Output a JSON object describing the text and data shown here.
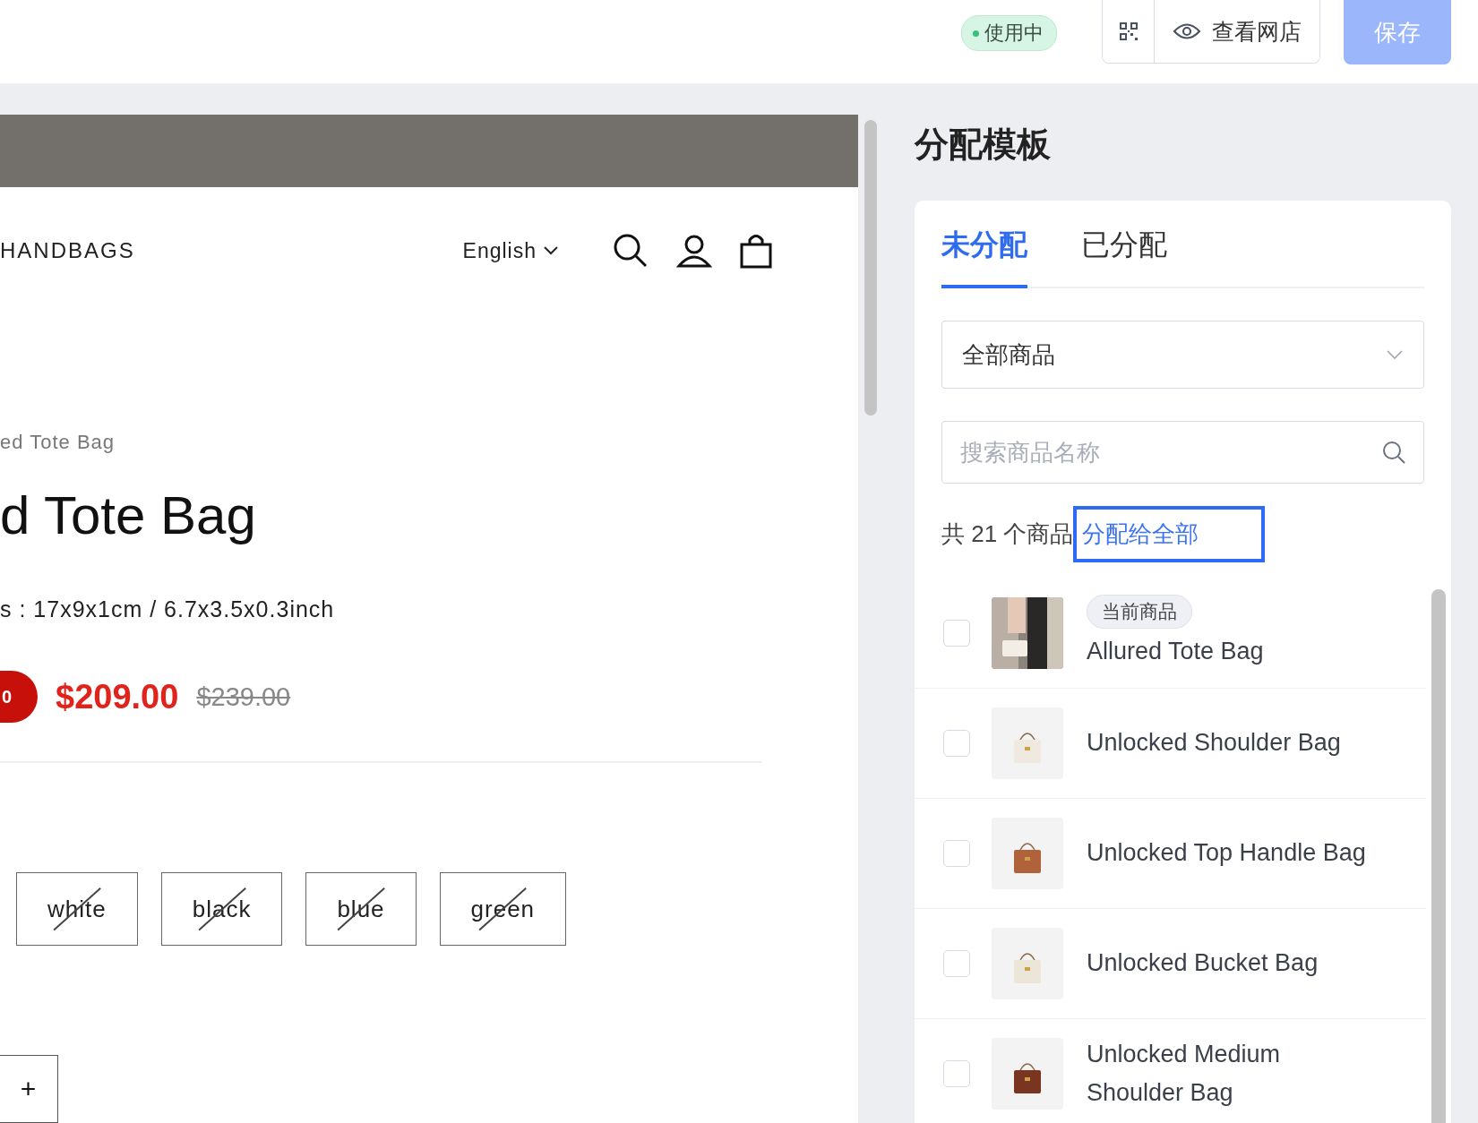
{
  "topbar": {
    "status": {
      "label": "使用中",
      "active": true
    },
    "view_store": "查看网店",
    "save": {
      "label": "保存",
      "disabled": true
    }
  },
  "preview": {
    "nav_title": "HANDBAGS",
    "language": "English",
    "breadcrumb": "ed Tote Bag",
    "product_title": "d Tote Bag",
    "spec": "s : 17x9x1cm / 6.7x3.5x0.3inch",
    "sale_badge": "0",
    "price": "$209.00",
    "compare_price": "$239.00",
    "variants": [
      {
        "label": "white",
        "unavailable": true
      },
      {
        "label": "black",
        "unavailable": true
      },
      {
        "label": "blue",
        "unavailable": true
      },
      {
        "label": "green",
        "unavailable": true
      }
    ],
    "quantity_plus": "+"
  },
  "panel": {
    "title": "分配模板",
    "tabs": [
      {
        "label": "未分配",
        "selected": true
      },
      {
        "label": "已分配",
        "selected": false
      }
    ],
    "filter": {
      "value": "全部商品"
    },
    "search": {
      "placeholder": "搜索商品名称"
    },
    "count": "共 21 个商品",
    "assign_all": {
      "label": "分配给全部",
      "focused": true
    },
    "products": [
      {
        "name": "Allured Tote Bag",
        "tag": "当前商品",
        "checked": false,
        "kind": "picture"
      },
      {
        "name": "Unlocked Shoulder Bag",
        "checked": false,
        "kind": "picture"
      },
      {
        "name": "Unlocked Top Handle Bag",
        "checked": false,
        "kind": "picture"
      },
      {
        "name": "Unlocked Bucket Bag",
        "checked": false,
        "kind": "picture"
      },
      {
        "name": "Unlocked Medium Shoulder Bag",
        "checked": false,
        "kind": "picture"
      }
    ]
  }
}
